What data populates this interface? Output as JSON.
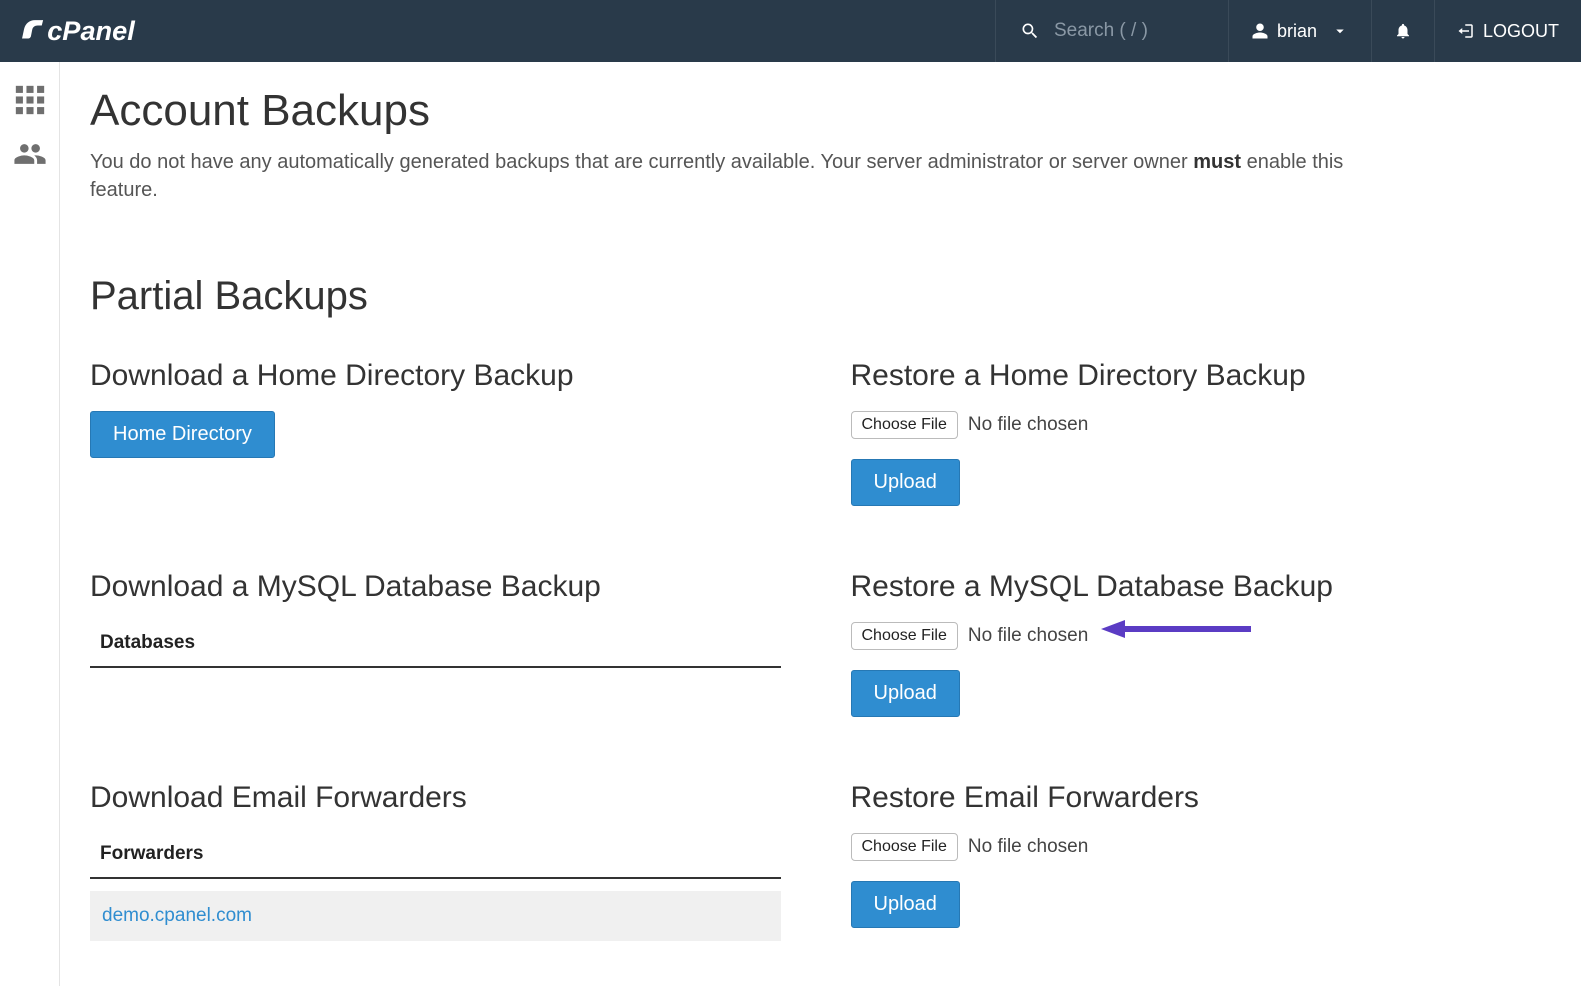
{
  "header": {
    "search_placeholder": "Search ( / )",
    "username": "brian",
    "logout": "LOGOUT"
  },
  "page": {
    "title": "Account Backups",
    "intro_before": "You do not have any automatically generated backups that are currently available. Your server administrator or server owner ",
    "intro_bold": "must",
    "intro_after": " enable this feature."
  },
  "partial": {
    "title": "Partial Backups",
    "download_home": {
      "title": "Download a Home Directory Backup",
      "button": "Home Directory"
    },
    "restore_home": {
      "title": "Restore a Home Directory Backup",
      "choose": "Choose File",
      "nofile": "No file chosen",
      "upload": "Upload"
    },
    "download_mysql": {
      "title": "Download a MySQL Database Backup",
      "subheading": "Databases"
    },
    "restore_mysql": {
      "title": "Restore a MySQL Database Backup",
      "choose": "Choose File",
      "nofile": "No file chosen",
      "upload": "Upload"
    },
    "download_forwarders": {
      "title": "Download Email Forwarders",
      "subheading": "Forwarders",
      "item": "demo.cpanel.com"
    },
    "restore_forwarders": {
      "title": "Restore Email Forwarders",
      "choose": "Choose File",
      "nofile": "No file chosen",
      "upload": "Upload"
    }
  }
}
